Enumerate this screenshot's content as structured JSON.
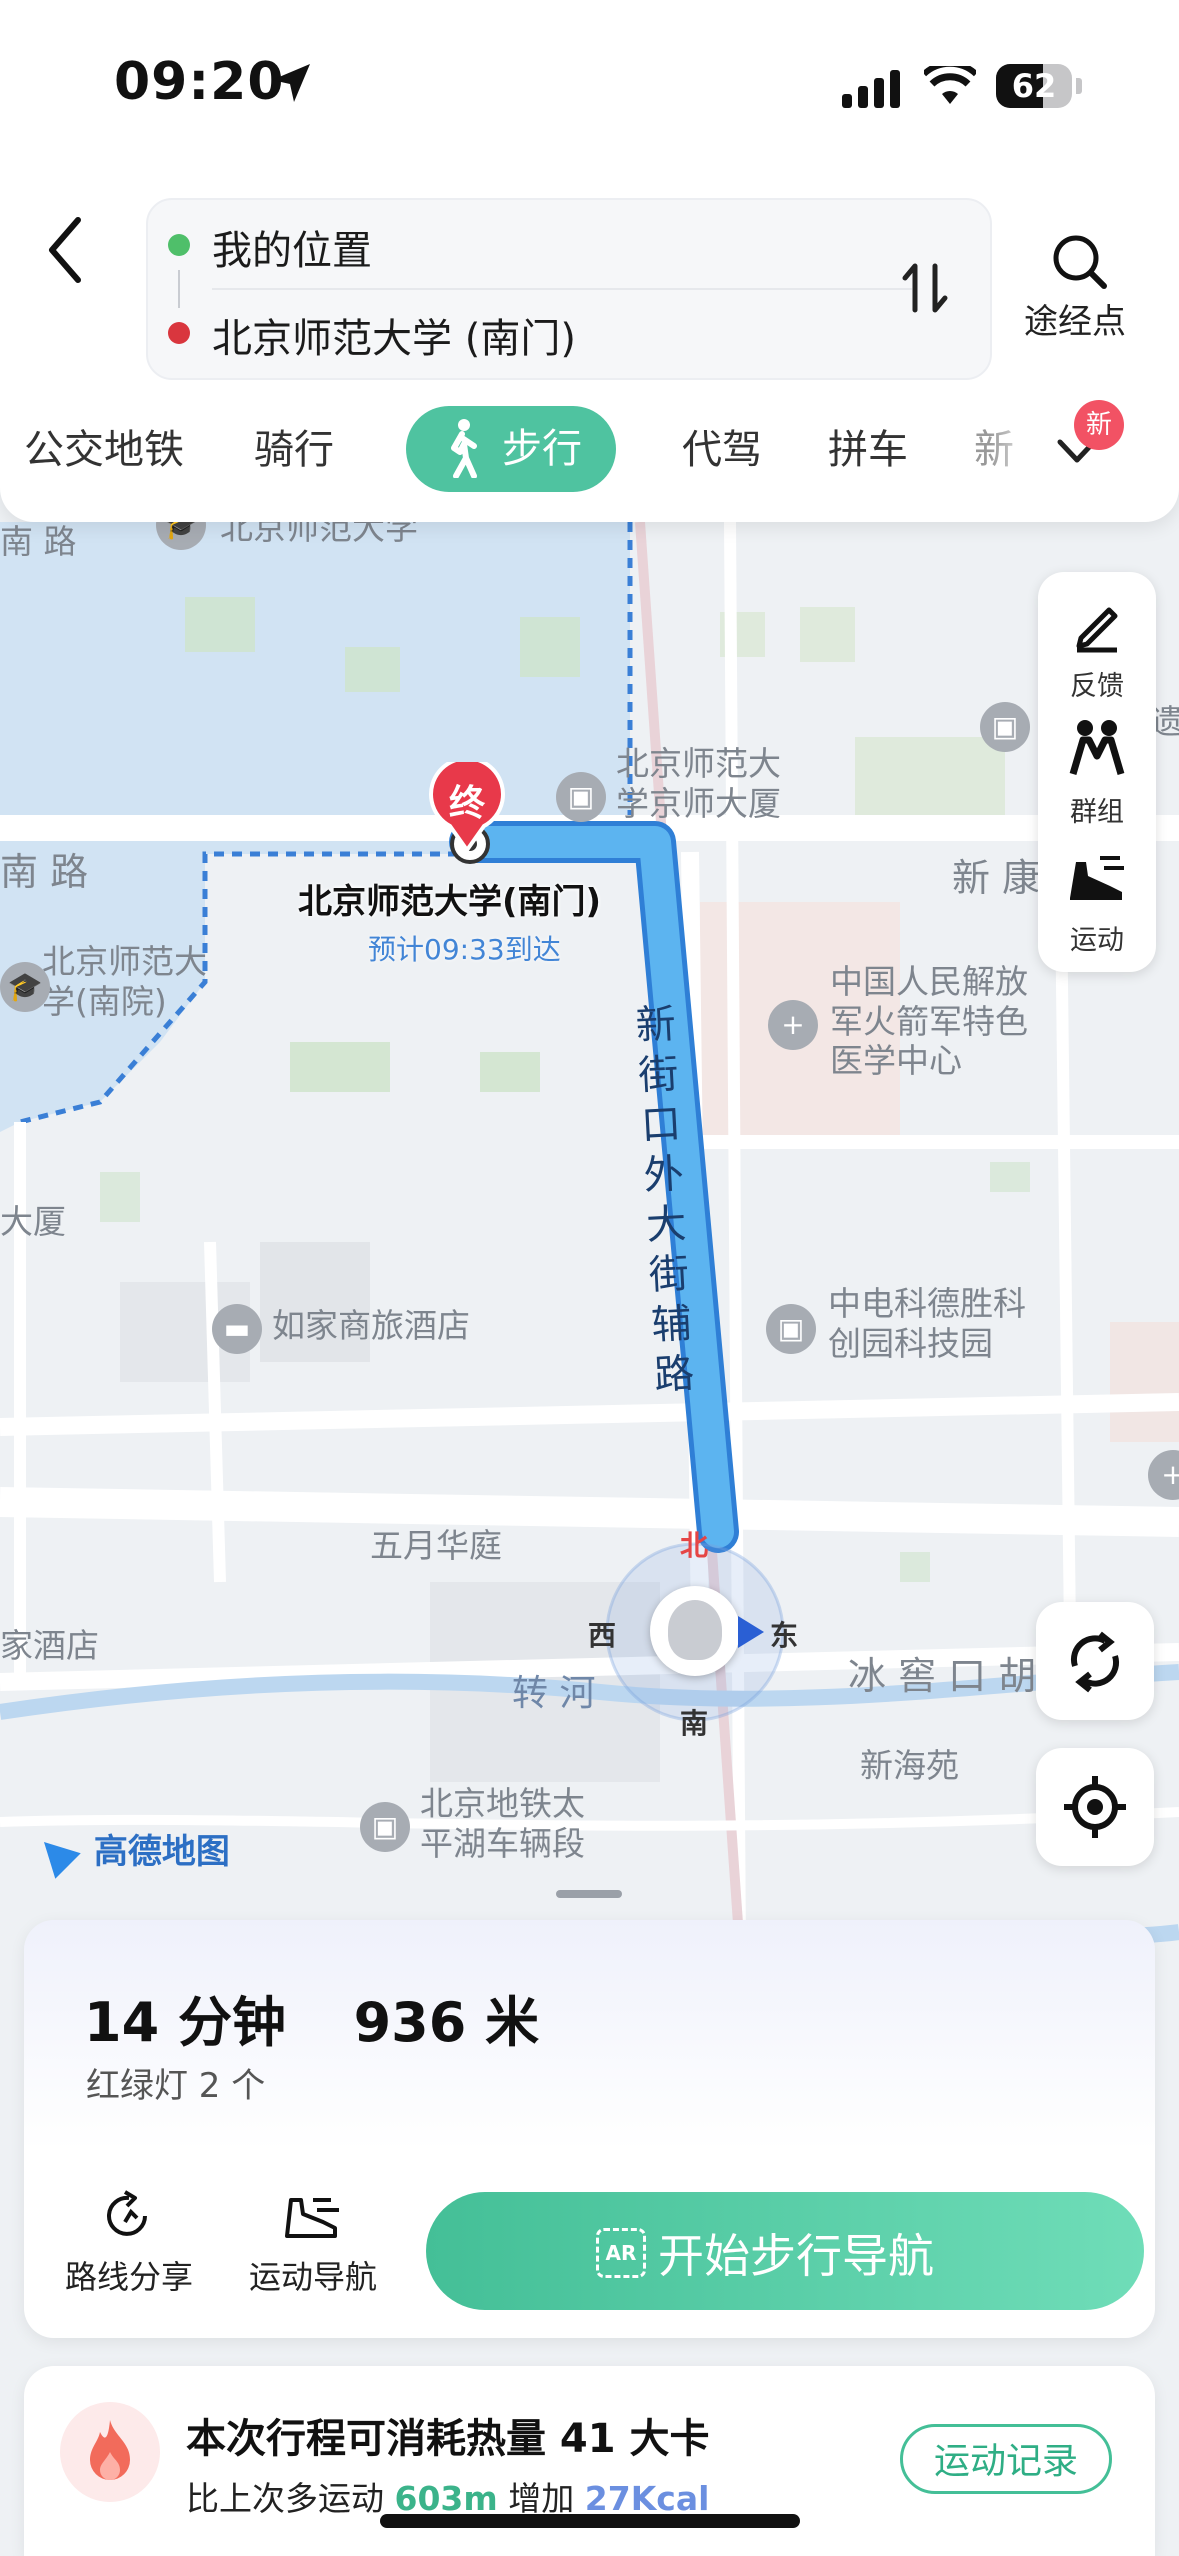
{
  "status_bar": {
    "time": "09:20",
    "battery": "62"
  },
  "route": {
    "origin": "我的位置",
    "destination": "北京师范大学 (南门)",
    "waypoint_label": "途经点"
  },
  "tabs": [
    {
      "label": "公交地铁"
    },
    {
      "label": "骑行"
    },
    {
      "label": "步行"
    },
    {
      "label": "代驾"
    },
    {
      "label": "拼车"
    },
    {
      "label": "新"
    }
  ],
  "new_badge": "新",
  "map": {
    "labels": {
      "bnu_top": "北京师范大学",
      "road_nan": "南 路",
      "bnu_south_campus": "北京师范大\n学(南院)",
      "teacher_building": "北京师范大\n学京师大厦",
      "xinkang": "新 康",
      "hospital": "中国人民解放\n军火箭军特色\n医学中心",
      "street_name": "新街口外大街辅路",
      "da_xia": "大厦",
      "rujia": "如家商旅酒店",
      "zhongdian": "中电科德胜科\n创园科技园",
      "wuyue": "五月华庭",
      "hotel_left": "家酒店",
      "zhuanhe": "转 河",
      "bingjiao": "冰 窖 口 胡",
      "xinhaiyuan": "新海苑",
      "subway_depot": "北京地铁太\n平湖车辆段",
      "yi": "遗",
      "brand": "高德地图"
    },
    "end_marker": "终",
    "destination_label": "北京师范大学(南门)",
    "eta": "预计09:33到达",
    "compass": {
      "n": "北",
      "s": "南",
      "w": "西",
      "e": "东"
    }
  },
  "side_controls": [
    {
      "label": "反馈",
      "icon": "feedback-pen-icon"
    },
    {
      "label": "群组",
      "icon": "group-people-icon"
    },
    {
      "label": "运动",
      "icon": "sport-shoe-icon"
    }
  ],
  "summary": {
    "duration": "14 分钟",
    "distance": "936 米",
    "traffic_lights": "红绿灯 2 个",
    "share_label": "路线分享",
    "sport_nav_label": "运动导航",
    "start_button": "开始步行导航",
    "ar_icon_text": "AR"
  },
  "calorie": {
    "title": "本次行程可消耗热量 41 大卡",
    "prefix": "比上次多运动",
    "extra_distance": "603m",
    "mid": "增加",
    "extra_kcal": "27Kcal",
    "record_button": "运动记录"
  },
  "colors": {
    "accent_green": "#4fc3a0",
    "route_blue": "#4aa3e8",
    "origin_dot": "#4fbf6a",
    "dest_dot": "#d9363e",
    "end_marker": "#e8394a"
  }
}
